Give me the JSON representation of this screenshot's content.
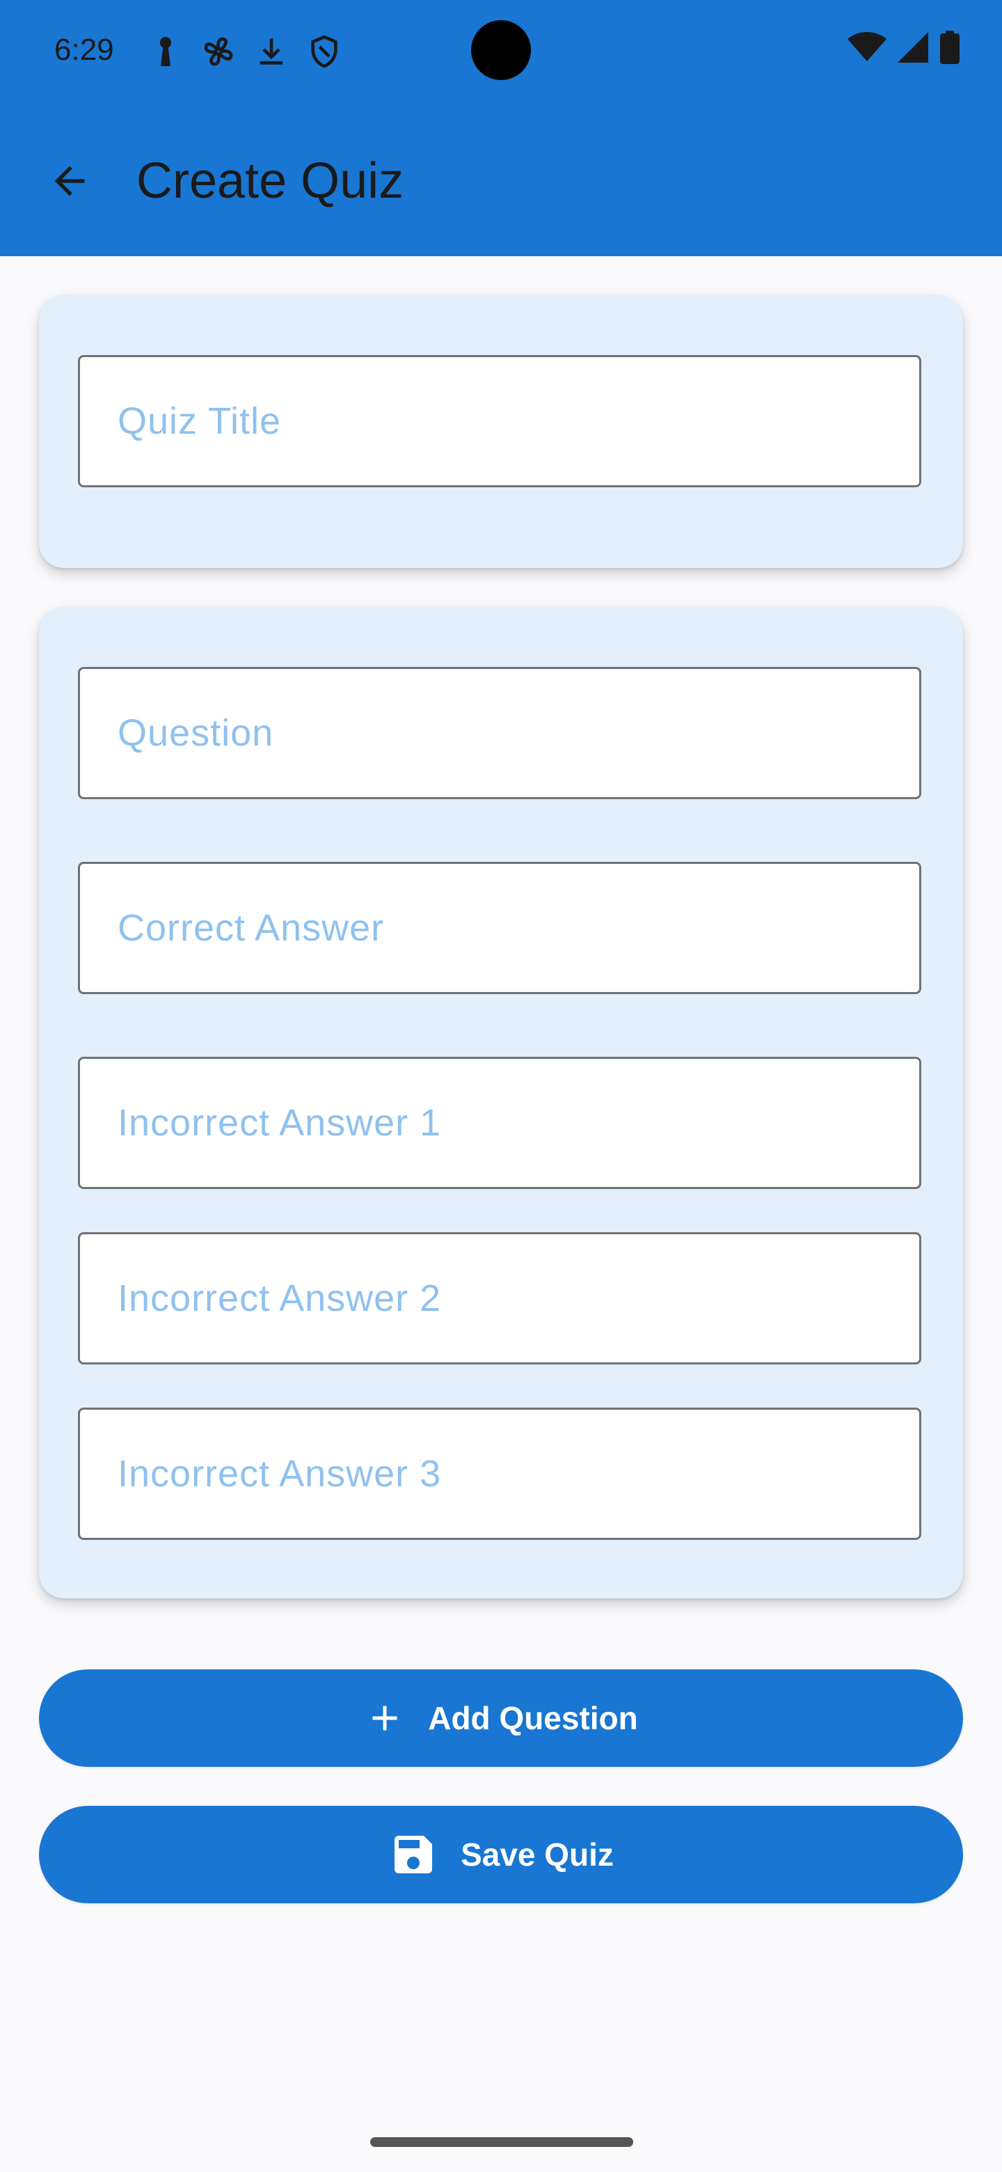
{
  "status_bar": {
    "time": "6:29",
    "left_icons": [
      "keyhole-icon",
      "fan-icon",
      "download-icon",
      "shield-icon"
    ],
    "right_icons": [
      "wifi-icon",
      "signal-icon",
      "battery-icon"
    ]
  },
  "app_bar": {
    "title": "Create Quiz",
    "back_icon": "arrow-back-icon"
  },
  "quiz_title_card": {
    "title_field": {
      "placeholder": "Quiz Title",
      "value": ""
    }
  },
  "question_card": {
    "question_field": {
      "placeholder": "Question",
      "value": ""
    },
    "correct_answer_field": {
      "placeholder": "Correct Answer",
      "value": ""
    },
    "incorrect_answer_1_field": {
      "placeholder": "Incorrect Answer 1",
      "value": ""
    },
    "incorrect_answer_2_field": {
      "placeholder": "Incorrect Answer 2",
      "value": ""
    },
    "incorrect_answer_3_field": {
      "placeholder": "Incorrect Answer 3",
      "value": ""
    }
  },
  "actions": {
    "add_question": {
      "label": "Add Question",
      "icon": "plus-icon"
    },
    "save_quiz": {
      "label": "Save Quiz",
      "icon": "save-icon"
    }
  },
  "colors": {
    "primary": "#1976D2",
    "card_background": "#E3F0FB",
    "placeholder_text": "#8FC1EE",
    "field_border": "#6F7378",
    "page_background": "#FAFAFC"
  }
}
